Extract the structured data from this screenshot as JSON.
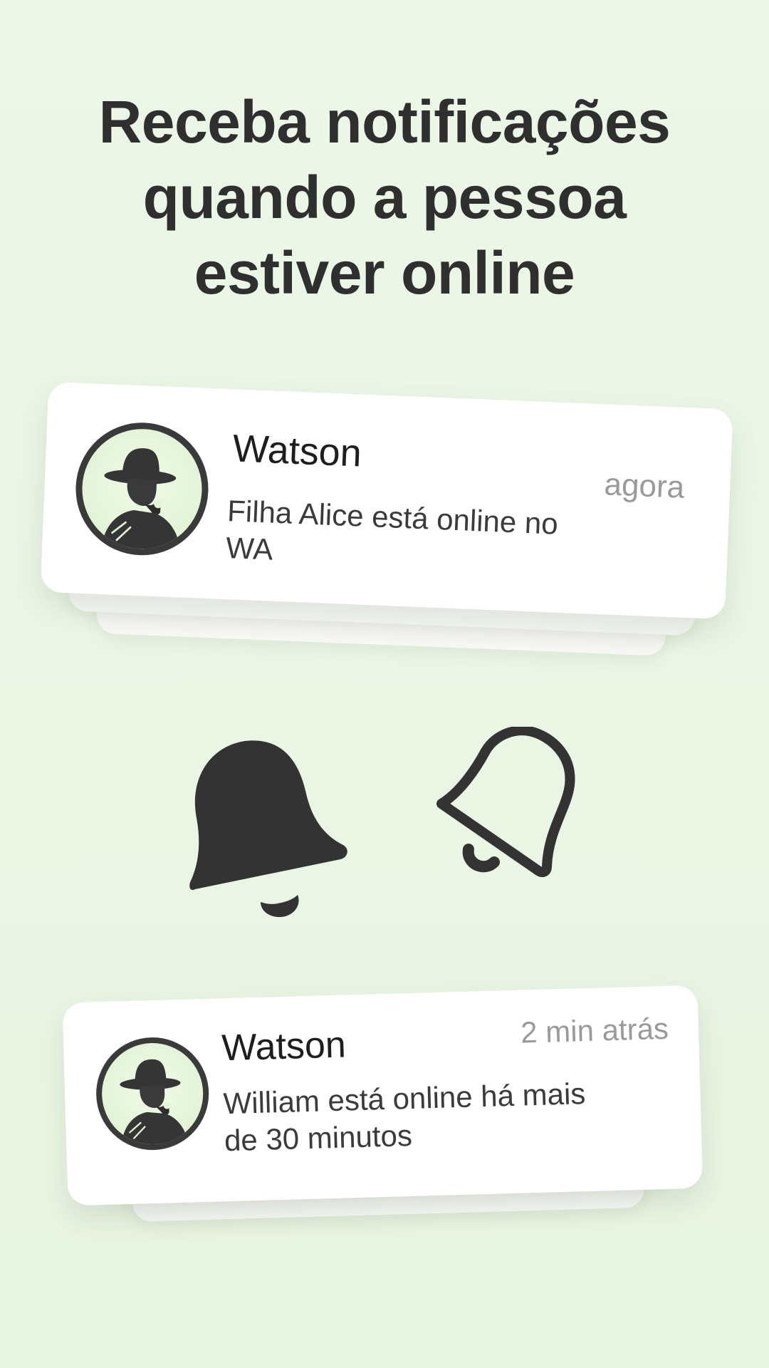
{
  "headline": {
    "line1": "Receba notificações",
    "line2": "quando a pessoa",
    "line3": "estiver online"
  },
  "notifications": [
    {
      "title": "Watson",
      "time": "agora",
      "message": "Filha Alice está online no WA",
      "avatar_icon": "detective-avatar-icon"
    },
    {
      "title": "Watson",
      "time": "2 min atrás",
      "message": "William está online há mais de 30 minutos",
      "avatar_icon": "detective-avatar-icon"
    }
  ],
  "icons": {
    "bell_filled": "bell-filled-icon",
    "bell_outline": "bell-outline-icon"
  },
  "colors": {
    "background": "#e9f5e3",
    "text_dark": "#2f2f2f",
    "time_gray": "#9a9a9a",
    "avatar_bg": "#e2f3d6",
    "icon_dark": "#333333"
  }
}
